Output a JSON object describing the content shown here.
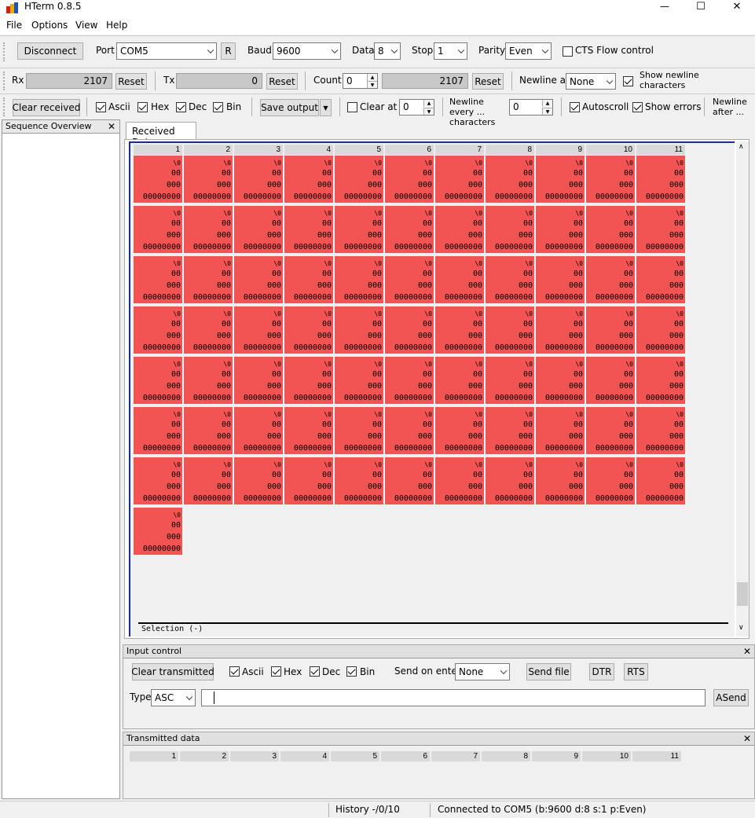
{
  "window": {
    "title": "HTerm 0.8.5",
    "minimize": "—",
    "maximize": "☐",
    "close": "✕"
  },
  "menu": [
    "File",
    "Options",
    "View",
    "Help"
  ],
  "conn": {
    "disconnect": "Disconnect",
    "port_label": "Port",
    "port_value": "COM5",
    "refresh": "R",
    "baud_label": "Baud",
    "baud_value": "9600",
    "data_label": "Data",
    "data_value": "8",
    "stop_label": "Stop",
    "stop_value": "1",
    "parity_label": "Parity",
    "parity_value": "Even",
    "cts_label": "CTS Flow control",
    "cts_checked": false
  },
  "counters": {
    "rx_label": "Rx",
    "rx_value": "2107",
    "rx_reset": "Reset",
    "tx_label": "Tx",
    "tx_value": "0",
    "tx_reset": "Reset",
    "count_label": "Count",
    "count_value": "0",
    "count_total": "2107",
    "count_reset": "Reset",
    "newline_at_label": "Newline at",
    "newline_at_value": "None",
    "show_newline_label": "Show newline characters",
    "show_newline_checked": true
  },
  "display": {
    "clear_received": "Clear received",
    "ascii": "Ascii",
    "hex": "Hex",
    "dec": "Dec",
    "bin": "Bin",
    "save_output": "Save output",
    "clear_at": "Clear at",
    "clear_at_value": "0",
    "newline_every": "Newline every ... characters",
    "newline_every_value": "0",
    "autoscroll": "Autoscroll",
    "show_errors": "Show errors",
    "newline_after": "Newline after ..."
  },
  "sequence_overview": {
    "title": "Sequence Overview",
    "close": "✕"
  },
  "received": {
    "tab": "Received Data",
    "columns": [
      "1",
      "2",
      "3",
      "4",
      "5",
      "6",
      "7",
      "8",
      "9",
      "10",
      "11"
    ],
    "cell": {
      "ascii": "\\0",
      "hex": "00",
      "dec": "000",
      "bin": "00000000"
    },
    "rows_full": 7,
    "last_row_count": 1,
    "selection": "Selection (-)",
    "cell_color": "#f25454"
  },
  "input": {
    "title": "Input control",
    "close": "✕",
    "clear_transmitted": "Clear transmitted",
    "ascii": "Ascii",
    "hex": "Hex",
    "dec": "Dec",
    "bin": "Bin",
    "send_on_enter_label": "Send on enter",
    "send_on_enter_value": "None",
    "send_file": "Send file",
    "dtr": "DTR",
    "rts": "RTS",
    "type_label": "Type",
    "type_value": "ASC",
    "input_value": "",
    "asend": "ASend"
  },
  "transmitted": {
    "title": "Transmitted data",
    "close": "✕",
    "columns": [
      "1",
      "2",
      "3",
      "4",
      "5",
      "6",
      "7",
      "8",
      "9",
      "10",
      "11"
    ]
  },
  "status": {
    "history": "History -/0/10",
    "connection": "Connected to COM5 (b:9600 d:8 s:1 p:Even)"
  }
}
